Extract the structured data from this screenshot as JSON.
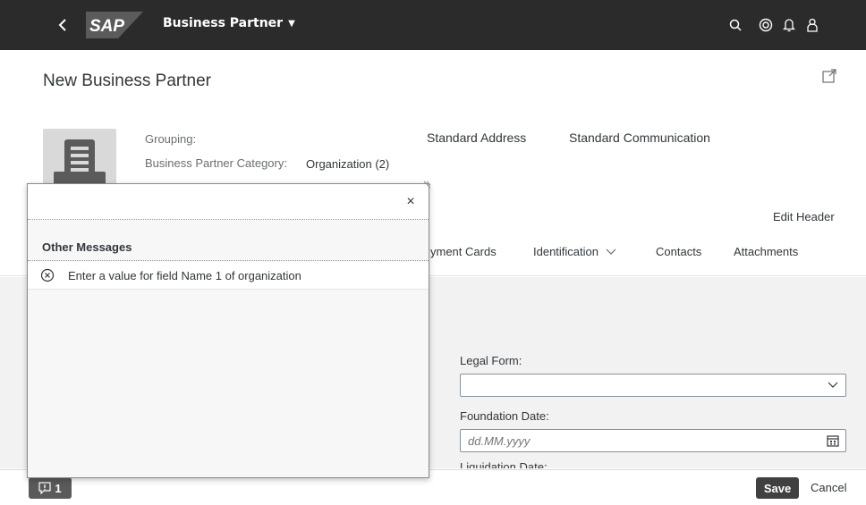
{
  "shell": {
    "back_icon": "chevron-left-icon",
    "logo_text": "SAP",
    "app_title": "Business Partner",
    "app_title_icon": "caret-down-icon",
    "icons": [
      "search-icon",
      "copilot-icon",
      "bell-icon",
      "user-icon"
    ]
  },
  "header": {
    "title": "New Business Partner",
    "share_icon": "share-icon",
    "grouping_label": "Grouping:",
    "grouping_value": "",
    "category_label": "Business Partner Category:",
    "category_value": "Organization (2)",
    "links": [
      "Standard Address",
      "Standard Communication"
    ],
    "edit_header": "Edit Header"
  },
  "tabs": [
    {
      "label": "yment Cards"
    },
    {
      "label": "Identification",
      "has_dropdown": true
    },
    {
      "label": "Contacts"
    },
    {
      "label": "Attachments"
    }
  ],
  "form": {
    "legal_form_label": "Legal Form:",
    "legal_form_value": "",
    "foundation_date_label": "Foundation Date:",
    "foundation_date_placeholder": "dd.MM.yyyy",
    "liquidation_date_label": "Liquidation Date:"
  },
  "popover": {
    "close_label": "×",
    "group_title": "Other Messages",
    "messages": [
      {
        "type": "error",
        "icon": "error-circle-icon",
        "text": "Enter a value for field Name 1 of organization"
      }
    ]
  },
  "footer": {
    "message_count": "1",
    "save_label": "Save",
    "cancel_label": "Cancel"
  },
  "colors": {
    "shell_bg": "#2b2b2b",
    "content_bg": "#f2f2f2",
    "save_bg": "#404040",
    "message_btn_bg": "#5a5a5a"
  }
}
